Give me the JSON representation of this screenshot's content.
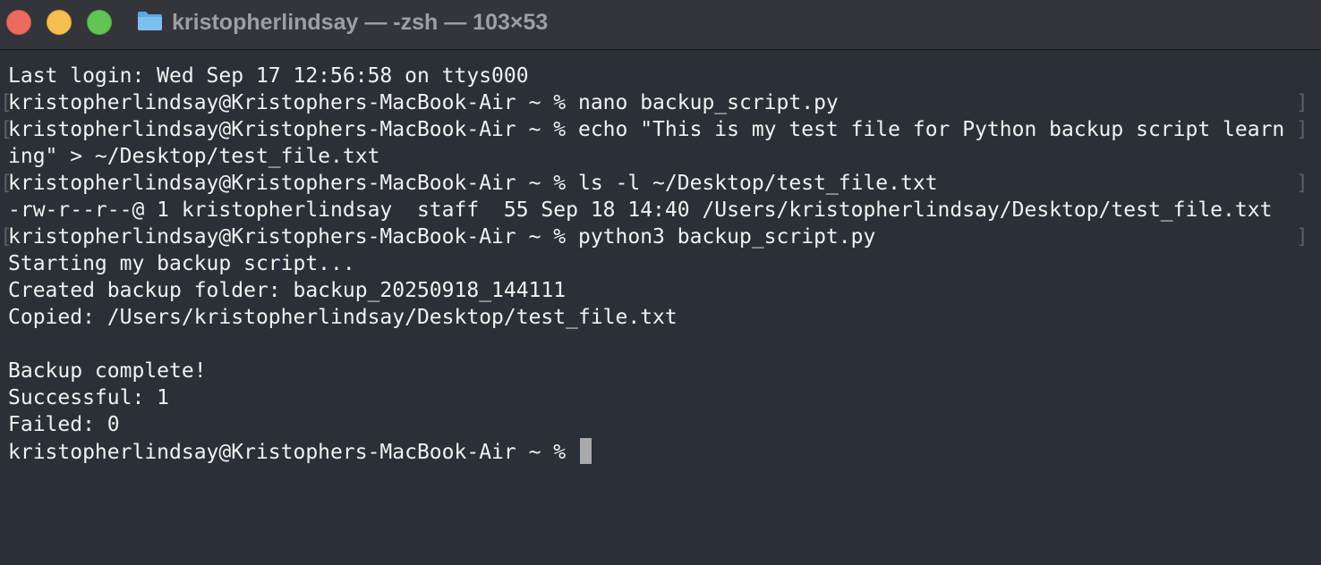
{
  "window": {
    "title": "kristopherlindsay — -zsh — 103×53",
    "folder_icon": "folder-icon",
    "traffic_lights": {
      "close_color": "#ed6a5e",
      "minimize_color": "#f5bf4f",
      "zoom_color": "#61c454"
    }
  },
  "terminal": {
    "background": "#2b2f38",
    "lines": [
      {
        "text": "Last login: Wed Sep 17 12:56:58 on ttys000"
      },
      {
        "text": "kristopherlindsay@Kristophers-MacBook-Air ~ % nano backup_script.py"
      },
      {
        "text": "kristopherlindsay@Kristophers-MacBook-Air ~ % echo \"This is my test file for Python backup script learn"
      },
      {
        "text": "ing\" > ~/Desktop/test_file.txt"
      },
      {
        "text": "kristopherlindsay@Kristophers-MacBook-Air ~ % ls -l ~/Desktop/test_file.txt"
      },
      {
        "text": "-rw-r--r--@ 1 kristopherlindsay  staff  55 Sep 18 14:40 /Users/kristopherlindsay/Desktop/test_file.txt"
      },
      {
        "text": "kristopherlindsay@Kristophers-MacBook-Air ~ % python3 backup_script.py"
      },
      {
        "text": "Starting my backup script..."
      },
      {
        "text": "Created backup folder: backup_20250918_144111"
      },
      {
        "text": "Copied: /Users/kristopherlindsay/Desktop/test_file.txt"
      },
      {
        "text": ""
      },
      {
        "text": "Backup complete!"
      },
      {
        "text": "Successful: 1"
      },
      {
        "text": "Failed: 0"
      }
    ],
    "prompt": "kristopherlindsay@Kristophers-MacBook-Air ~ % "
  }
}
